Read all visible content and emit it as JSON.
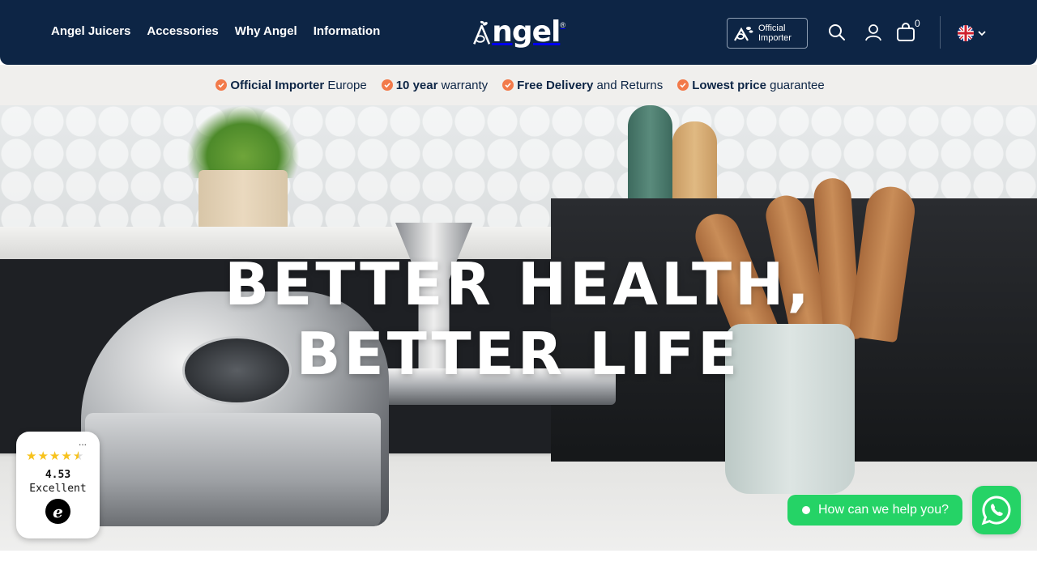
{
  "header": {
    "nav": [
      "Angel Juicers",
      "Accessories",
      "Why Angel",
      "Information"
    ],
    "logo_text": "ngel",
    "logo_reg": "®",
    "importer_badge_line1": "Official",
    "importer_badge_line2": "Importer",
    "cart_count": "0",
    "language_flag": "uk-flag-icon"
  },
  "usp": [
    {
      "bold": "Official Importer",
      "rest": " Europe"
    },
    {
      "bold": "10 year",
      "rest": " warranty"
    },
    {
      "bold": "Free Delivery",
      "rest": " and Returns"
    },
    {
      "bold": "Lowest price",
      "rest": " guarantee"
    }
  ],
  "hero": {
    "title_line1": "BETTER HEALTH,",
    "title_line2": "BETTER LIFE"
  },
  "trust_widget": {
    "dots": "...",
    "rating": 4.5,
    "score": "4.53",
    "label": "Excellent",
    "logo_letter": "e"
  },
  "chat": {
    "prompt": "How can we help you?"
  },
  "colors": {
    "header_bg": "#0d2545",
    "usp_bg": "#f0efed",
    "check": "#f27a4a",
    "whatsapp": "#25d366",
    "star": "#f7c21c"
  }
}
